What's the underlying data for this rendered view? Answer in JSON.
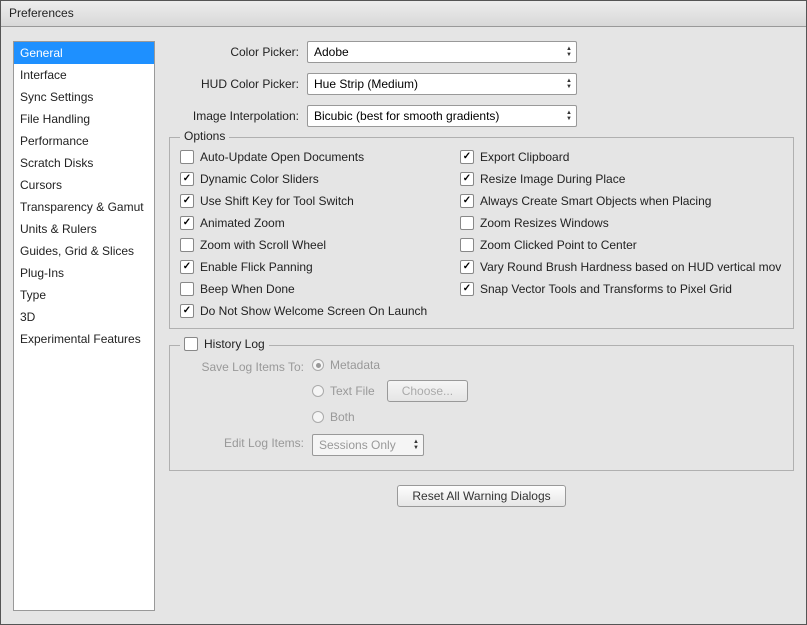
{
  "window": {
    "title": "Preferences"
  },
  "sidebar": {
    "items": [
      "General",
      "Interface",
      "Sync Settings",
      "File Handling",
      "Performance",
      "Scratch Disks",
      "Cursors",
      "Transparency & Gamut",
      "Units & Rulers",
      "Guides, Grid & Slices",
      "Plug-Ins",
      "Type",
      "3D",
      "Experimental Features"
    ],
    "selected_index": 0
  },
  "general": {
    "color_picker_label": "Color Picker:",
    "color_picker_value": "Adobe",
    "hud_label": "HUD Color Picker:",
    "hud_value": "Hue Strip (Medium)",
    "interp_label": "Image Interpolation:",
    "interp_value": "Bicubic (best for smooth gradients)"
  },
  "options": {
    "group_title": "Options",
    "left": [
      {
        "label": "Auto-Update Open Documents",
        "checked": false
      },
      {
        "label": "Dynamic Color Sliders",
        "checked": true
      },
      {
        "label": "Use Shift Key for Tool Switch",
        "checked": true
      },
      {
        "label": "Animated Zoom",
        "checked": true
      },
      {
        "label": "Zoom with Scroll Wheel",
        "checked": false
      },
      {
        "label": "Enable Flick Panning",
        "checked": true
      },
      {
        "label": "Beep When Done",
        "checked": false
      }
    ],
    "right": [
      {
        "label": "Export Clipboard",
        "checked": true
      },
      {
        "label": "Resize Image During Place",
        "checked": true
      },
      {
        "label": "Always Create Smart Objects when Placing",
        "checked": true
      },
      {
        "label": "Zoom Resizes Windows",
        "checked": false
      },
      {
        "label": "Zoom Clicked Point to Center",
        "checked": false
      },
      {
        "label": "Vary Round Brush Hardness based on HUD vertical mov",
        "checked": true
      },
      {
        "label": "Snap Vector Tools and Transforms to Pixel Grid",
        "checked": true
      }
    ],
    "last": {
      "label": "Do Not Show Welcome Screen On Launch",
      "checked": true
    }
  },
  "history": {
    "group_title": "History Log",
    "enabled": false,
    "save_label": "Save Log Items To:",
    "edit_label": "Edit Log Items:",
    "radios": [
      "Metadata",
      "Text File",
      "Both"
    ],
    "radio_selected": 0,
    "choose_btn": "Choose...",
    "edit_value": "Sessions Only"
  },
  "reset_btn": "Reset All Warning Dialogs"
}
